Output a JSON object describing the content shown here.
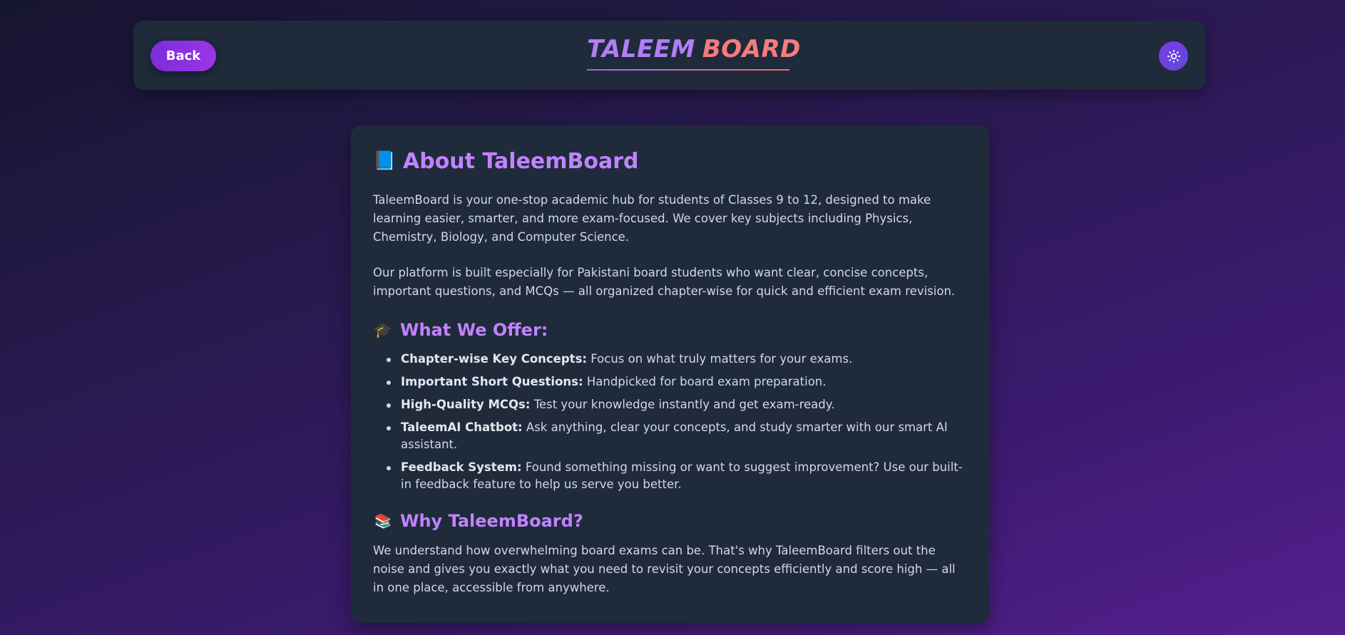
{
  "header": {
    "back_label": "Back",
    "brand_first": "TALEEM",
    "brand_second": "BOARD",
    "theme_toggle_icon": "sun-icon"
  },
  "about": {
    "icon": "📘",
    "title": "About TaleemBoard",
    "paragraph_1": "TaleemBoard is your one-stop academic hub for students of Classes 9 to 12, designed to make learning easier, smarter, and more exam-focused. We cover key subjects including Physics, Chemistry, Biology, and Computer Science.",
    "paragraph_2": "Our platform is built especially for Pakistani board students who want clear, concise concepts, important questions, and MCQs — all organized chapter-wise for quick and efficient exam revision."
  },
  "offer": {
    "icon": "🎓",
    "title": "What We Offer:",
    "items": [
      {
        "label": "Chapter-wise Key Concepts:",
        "text": " Focus on what truly matters for your exams."
      },
      {
        "label": "Important Short Questions:",
        "text": " Handpicked for board exam preparation."
      },
      {
        "label": "High-Quality MCQs:",
        "text": " Test your knowledge instantly and get exam-ready."
      },
      {
        "label": "TaleemAI Chatbot:",
        "text": " Ask anything, clear your concepts, and study smarter with our smart AI assistant."
      },
      {
        "label": "Feedback System:",
        "text": " Found something missing or want to suggest improvement? Use our built-in feedback feature to help us serve you better."
      }
    ]
  },
  "why": {
    "icon": "📚",
    "title": "Why TaleemBoard?",
    "paragraph": "We understand how overwhelming board exams can be. That's why TaleemBoard filters out the noise and gives you exactly what you need to revisit your concepts efficiently and score high — all in one place, accessible from anywhere."
  },
  "colors": {
    "accent_purple": "#c084fc",
    "brand_coral": "#f47c7c",
    "button_purple": "#7c2ddc",
    "card_bg": "#1f2a3b"
  }
}
